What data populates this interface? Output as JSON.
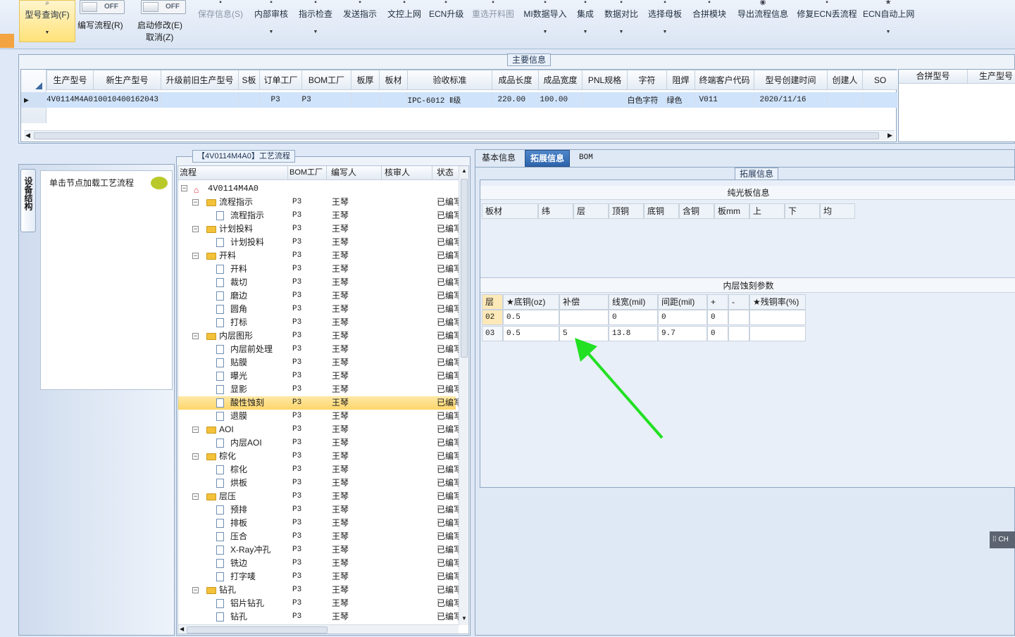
{
  "ribbon": {
    "query_label": "型号查询(F)",
    "toggle1_state": "OFF",
    "toggle1_label": "编写流程(R)",
    "toggle2_state": "OFF",
    "toggle2_label": "启动修改(E)",
    "cancel_label": "取消(Z)",
    "buttons": [
      "保存信息(S)",
      "内部审核",
      "指示检查",
      "发送指示",
      "文控上网",
      "ECN升级",
      "重选开料图",
      "MI数据导入",
      "集成",
      "数据对比",
      "选择母板",
      "合拼模块",
      "导出流程信息",
      "修复ECN丢流程",
      "ECN自动上网"
    ]
  },
  "main_info": {
    "title": "主要信息",
    "columns": [
      "生产型号",
      "新生产型号",
      "升级前旧生产型号",
      "S板",
      "订单工厂",
      "BOM工厂",
      "板厚",
      "板材",
      "验收标准",
      "成品长度",
      "成品宽度",
      "PNL规格",
      "字符",
      "阻焊",
      "终端客户代码",
      "型号创建时间",
      "创建人",
      "SO"
    ],
    "row": [
      "4V0114M4A0",
      "10010400162043",
      "",
      "",
      "P3",
      "P3",
      "",
      "",
      "IPC-6012 Ⅱ级",
      "220.00",
      "100.00",
      "",
      "白色字符",
      "绿色",
      "V011",
      "2020/11/16",
      "",
      ""
    ],
    "side_columns": [
      "合拼型号",
      "生产型号"
    ]
  },
  "left_tab": {
    "vertical_label": "设备结构",
    "node_hint": "单击节点加载工艺流程"
  },
  "flow": {
    "title": "【4V0114M4A0】工艺流程",
    "headers": [
      "流程",
      "BOM工厂",
      "编写人",
      "核审人",
      "状态"
    ],
    "root": "4V0114M4A0",
    "rows": [
      {
        "label": "流程指示",
        "folder": true,
        "level": 1,
        "bom": "P3",
        "author": "王琴",
        "status": "已编写"
      },
      {
        "label": "流程指示",
        "folder": false,
        "level": 2,
        "bom": "P3",
        "author": "王琴",
        "status": "已编写"
      },
      {
        "label": "计划投料",
        "folder": true,
        "level": 1,
        "bom": "P3",
        "author": "王琴",
        "status": "已编写"
      },
      {
        "label": "计划投料",
        "folder": false,
        "level": 2,
        "bom": "P3",
        "author": "王琴",
        "status": "已编写"
      },
      {
        "label": "开料",
        "folder": true,
        "level": 1,
        "bom": "P3",
        "author": "王琴",
        "status": "已编写"
      },
      {
        "label": "开料",
        "folder": false,
        "level": 2,
        "bom": "P3",
        "author": "王琴",
        "status": "已编写"
      },
      {
        "label": "裁切",
        "folder": false,
        "level": 2,
        "bom": "P3",
        "author": "王琴",
        "status": "已编写"
      },
      {
        "label": "磨边",
        "folder": false,
        "level": 2,
        "bom": "P3",
        "author": "王琴",
        "status": "已编写"
      },
      {
        "label": "圆角",
        "folder": false,
        "level": 2,
        "bom": "P3",
        "author": "王琴",
        "status": "已编写"
      },
      {
        "label": "打标",
        "folder": false,
        "level": 2,
        "bom": "P3",
        "author": "王琴",
        "status": "已编写"
      },
      {
        "label": "内层图形",
        "folder": true,
        "level": 1,
        "bom": "P3",
        "author": "王琴",
        "status": "已编写"
      },
      {
        "label": "内层前处理",
        "folder": false,
        "level": 2,
        "bom": "P3",
        "author": "王琴",
        "status": "已编写"
      },
      {
        "label": "贴膜",
        "folder": false,
        "level": 2,
        "bom": "P3",
        "author": "王琴",
        "status": "已编写"
      },
      {
        "label": "曝光",
        "folder": false,
        "level": 2,
        "bom": "P3",
        "author": "王琴",
        "status": "已编写"
      },
      {
        "label": "显影",
        "folder": false,
        "level": 2,
        "bom": "P3",
        "author": "王琴",
        "status": "已编写"
      },
      {
        "label": "酸性蚀刻",
        "folder": false,
        "level": 2,
        "bom": "P3",
        "author": "王琴",
        "status": "已编写",
        "selected": true
      },
      {
        "label": "退膜",
        "folder": false,
        "level": 2,
        "bom": "P3",
        "author": "王琴",
        "status": "已编写"
      },
      {
        "label": "AOI",
        "folder": true,
        "level": 1,
        "bom": "P3",
        "author": "王琴",
        "status": "已编写"
      },
      {
        "label": "内层AOI",
        "folder": false,
        "level": 2,
        "bom": "P3",
        "author": "王琴",
        "status": "已编写"
      },
      {
        "label": "棕化",
        "folder": true,
        "level": 1,
        "bom": "P3",
        "author": "王琴",
        "status": "已编写"
      },
      {
        "label": "棕化",
        "folder": false,
        "level": 2,
        "bom": "P3",
        "author": "王琴",
        "status": "已编写"
      },
      {
        "label": "烘板",
        "folder": false,
        "level": 2,
        "bom": "P3",
        "author": "王琴",
        "status": "已编写"
      },
      {
        "label": "层压",
        "folder": true,
        "level": 1,
        "bom": "P3",
        "author": "王琴",
        "status": "已编写"
      },
      {
        "label": "预排",
        "folder": false,
        "level": 2,
        "bom": "P3",
        "author": "王琴",
        "status": "已编写"
      },
      {
        "label": "排板",
        "folder": false,
        "level": 2,
        "bom": "P3",
        "author": "王琴",
        "status": "已编写"
      },
      {
        "label": "压合",
        "folder": false,
        "level": 2,
        "bom": "P3",
        "author": "王琴",
        "status": "已编写"
      },
      {
        "label": "X-Ray冲孔",
        "folder": false,
        "level": 2,
        "bom": "P3",
        "author": "王琴",
        "status": "已编写"
      },
      {
        "label": "铣边",
        "folder": false,
        "level": 2,
        "bom": "P3",
        "author": "王琴",
        "status": "已编写"
      },
      {
        "label": "打字唛",
        "folder": false,
        "level": 2,
        "bom": "P3",
        "author": "王琴",
        "status": "已编写"
      },
      {
        "label": "钻孔",
        "folder": true,
        "level": 1,
        "bom": "P3",
        "author": "王琴",
        "status": "已编写"
      },
      {
        "label": "铝片钻孔",
        "folder": false,
        "level": 2,
        "bom": "P3",
        "author": "王琴",
        "status": "已编写"
      },
      {
        "label": "钻孔",
        "folder": false,
        "level": 2,
        "bom": "P3",
        "author": "王琴",
        "status": "已编写"
      }
    ]
  },
  "detail": {
    "tabs": [
      "基本信息",
      "拓展信息",
      "BOM"
    ],
    "active_tab": "拓展信息",
    "group_title": "拓展信息",
    "plain_board": {
      "title": "纯光板信息",
      "columns": [
        "板材",
        "纬",
        "层",
        "顶铜",
        "底铜",
        "含铜",
        "板mm",
        "上",
        "下",
        "均"
      ]
    },
    "inner_etch": {
      "title": "内层蚀刻参数",
      "columns": [
        "层",
        "★底铜(oz)",
        "补偿",
        "线宽(mil)",
        "间距(mil)",
        "+",
        "-",
        "★残铜率(%)"
      ],
      "rows": [
        [
          "02",
          "0.5",
          "",
          "0",
          "0",
          "0",
          "",
          ""
        ],
        [
          "03",
          "0.5",
          "5",
          "13.8",
          "9.7",
          "0",
          "",
          ""
        ]
      ]
    },
    "ime_label": "CH"
  },
  "colors": {
    "annotation_arrow": "#22e022",
    "accent": "#2c64ac"
  }
}
